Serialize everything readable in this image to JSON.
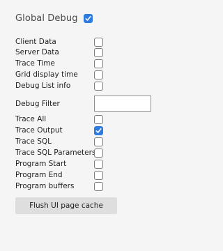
{
  "global": {
    "label": "Global Debug",
    "checked": true
  },
  "options_top": [
    {
      "label": "Client Data",
      "checked": false
    },
    {
      "label": "Server Data",
      "checked": false
    },
    {
      "label": "Trace Time",
      "checked": false
    },
    {
      "label": "Grid display time",
      "checked": false
    },
    {
      "label": "Debug List info",
      "checked": false
    }
  ],
  "filter": {
    "label": "Debug Filter",
    "value": ""
  },
  "options_bottom": [
    {
      "label": "Trace All",
      "checked": false
    },
    {
      "label": "Trace Output",
      "checked": true
    },
    {
      "label": "Trace SQL",
      "checked": false
    },
    {
      "label": "Trace SQL Parameters",
      "checked": false
    },
    {
      "label": "Program Start",
      "checked": false
    },
    {
      "label": "Program End",
      "checked": false
    },
    {
      "label": "Program buffers",
      "checked": false
    }
  ],
  "flush_button": {
    "label": "Flush UI page cache"
  },
  "colors": {
    "accent": "#2e7be0",
    "background": "#f5f5f5",
    "button": "#dedede"
  }
}
